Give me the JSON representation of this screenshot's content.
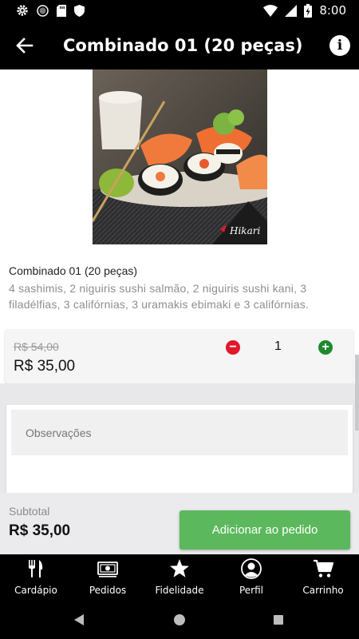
{
  "status_bar": {
    "time": "8:00",
    "icons": [
      "settings-gear-icon",
      "circle-icon",
      "sd-card-icon",
      "shield-icon",
      "wifi-icon",
      "signal-icon",
      "battery-charging-icon"
    ]
  },
  "app_bar": {
    "title": "Combinado 01 (20 peças)",
    "back_icon": "arrow-back-icon",
    "info_icon": "info-icon",
    "info_glyph": "i"
  },
  "product": {
    "image_alt": "Combinado de sushi e sashimi",
    "logo_text": "Hikari",
    "name": "Combinado 01 (20 peças)",
    "description": "4 sashimis, 2 niguiris sushi salmão, 2 niguiris sushi kani, 3 filadélfias, 3 califórnias, 3 uramakis ebimaki e 3 califórnias."
  },
  "pricing": {
    "old_price": "R$ 54,00",
    "new_price": "R$ 35,00",
    "quantity": "1",
    "minus_glyph": "−",
    "plus_glyph": "+"
  },
  "observations": {
    "placeholder": "Observações"
  },
  "footer": {
    "subtotal_label": "Subtotal",
    "subtotal_value": "R$ 35,00",
    "add_button_label": "Adicionar ao pedido"
  },
  "bottom_nav": {
    "items": [
      {
        "label": "Cardápio",
        "icon": "fork-knife-icon"
      },
      {
        "label": "Pedidos",
        "icon": "cash-icon"
      },
      {
        "label": "Fidelidade",
        "icon": "star-icon"
      },
      {
        "label": "Perfil",
        "icon": "profile-icon"
      },
      {
        "label": "Carrinho",
        "icon": "cart-icon"
      }
    ]
  },
  "colors": {
    "bar_background": "#000000",
    "add_button": "#5cb85c",
    "minus_red": "#e0192b",
    "plus_green": "#1e8a2f"
  }
}
